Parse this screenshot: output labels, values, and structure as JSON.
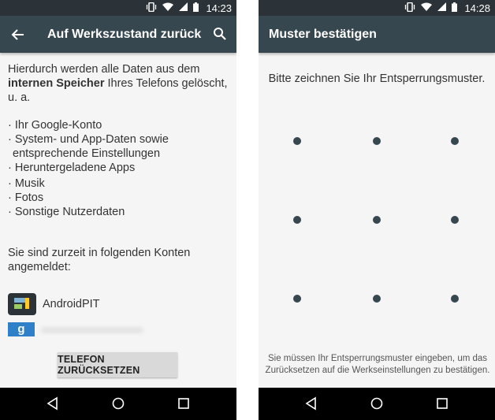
{
  "left": {
    "status": {
      "time": "14:23"
    },
    "appbar": {
      "title": "Auf Werkszustand zurück"
    },
    "intro": {
      "part1": "Hierdurch werden alle Daten aus dem ",
      "bold": "internen Speicher",
      "part2": " Ihres Telefons gelöscht, u. a."
    },
    "items": [
      "· Ihr Google-Konto",
      "· System- und App-Daten sowie entsprechende Einstellungen",
      "· Heruntergeladene Apps",
      "· Musik",
      "· Fotos",
      "· Sonstige Nutzerdaten"
    ],
    "accounts_heading": "Sie sind zurzeit in folgenden Konten angemeldet:",
    "accounts": [
      {
        "name": "AndroidPIT",
        "icon": "androidpit-app-icon"
      },
      {
        "name": "",
        "icon": "google-account-icon"
      }
    ],
    "reset_button": "TELEFON ZURÜCKSETZEN"
  },
  "right": {
    "status": {
      "time": "14:28"
    },
    "appbar": {
      "title": "Muster bestätigen"
    },
    "prompt": "Bitte zeichnen Sie Ihr Entsperrungsmuster.",
    "footnote": "Sie müssen Ihr Entsperrungsmuster eingeben, um das Zurücksetzen auf die Werkseinstellungen zu bestätigen."
  },
  "colors": {
    "status_bar": "#2b3338",
    "app_bar": "#37474f",
    "background": "#f5f5f5",
    "button": "#d9d9d9",
    "pattern_dot": "#37474f"
  }
}
